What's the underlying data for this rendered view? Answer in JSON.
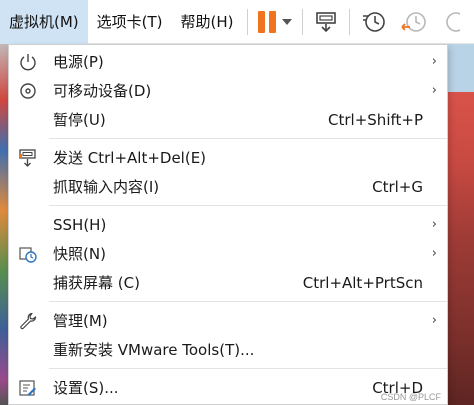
{
  "menubar": {
    "items": [
      {
        "label": "虚拟机(M)"
      },
      {
        "label": "选项卡(T)"
      },
      {
        "label": "帮助(H)"
      }
    ]
  },
  "menu": {
    "power": {
      "label": "电源(P)",
      "icon": "power-icon"
    },
    "removable": {
      "label": "可移动设备(D)",
      "icon": "disc-icon"
    },
    "pause": {
      "label": "暂停(U)",
      "shortcut": "Ctrl+Shift+P"
    },
    "send_cad": {
      "label": "发送 Ctrl+Alt+Del(E)",
      "icon": "send-keys-icon"
    },
    "grab_input": {
      "label": "抓取输入内容(I)",
      "shortcut": "Ctrl+G"
    },
    "ssh": {
      "label": "SSH(H)"
    },
    "snapshot": {
      "label": "快照(N)",
      "icon": "snapshot-icon"
    },
    "capture_screen": {
      "label": "捕获屏幕 (C)",
      "shortcut": "Ctrl+Alt+PrtScn"
    },
    "manage": {
      "label": "管理(M)",
      "icon": "wrench-icon"
    },
    "reinstall_tools": {
      "label": "重新安装 VMware Tools(T)..."
    },
    "settings": {
      "label": "设置(S)...",
      "shortcut": "Ctrl+D",
      "icon": "settings-icon"
    },
    "submenu_arrow": "›"
  },
  "watermark": "CSDN @PLCF",
  "colors": {
    "active_menu": "#cfe3f5",
    "pause_orange": "#f0731f"
  }
}
